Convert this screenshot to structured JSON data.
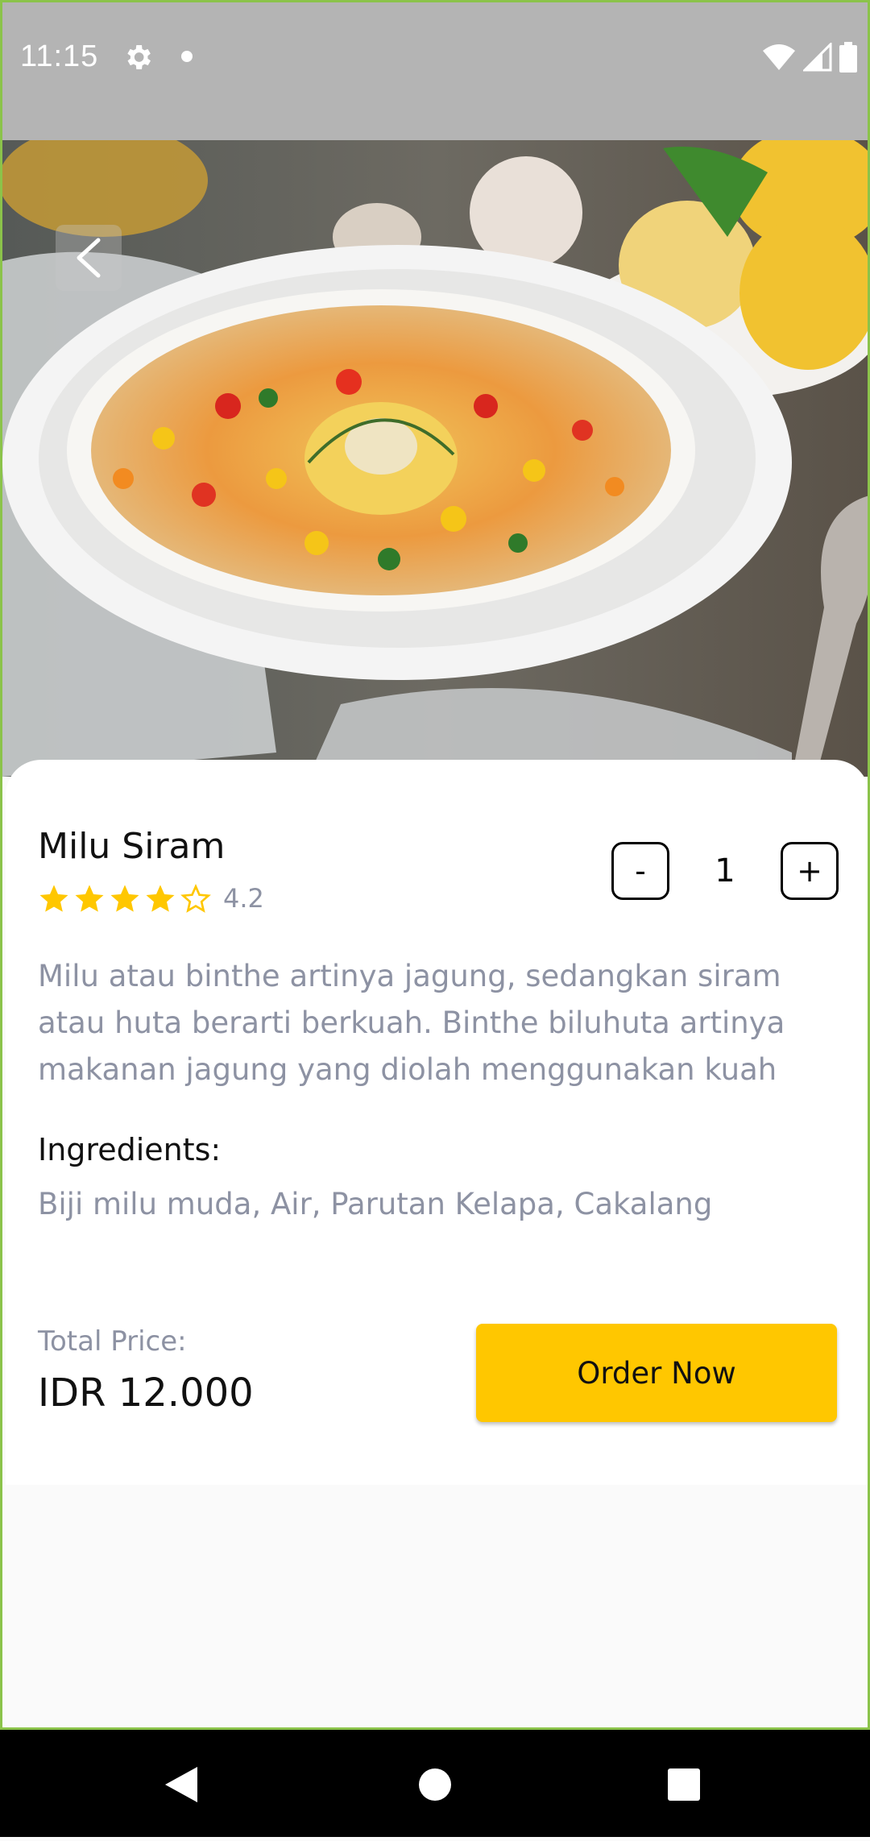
{
  "status_bar": {
    "time": "11:15",
    "icons": [
      "settings-gear-icon",
      "notification-dot-icon",
      "wifi-icon",
      "signal-icon",
      "battery-icon"
    ]
  },
  "hero": {
    "image_description_icon": "corn-soup-photo",
    "back_icon": "chevron-left-icon"
  },
  "food": {
    "name": "Milu Siram",
    "rating_value": "4.2",
    "rating_stars": 4.2,
    "rating_max": 5,
    "quantity": "1",
    "decrement_label": "-",
    "increment_label": "+",
    "description": "Milu atau binthe artinya jagung, sedangkan siram atau huta berarti berkuah. Binthe biluhuta artinya makanan jagung yang diolah menggunakan kuah",
    "ingredients_label": "Ingredients:",
    "ingredients": "Biji milu muda, Air, Parutan Kelapa, Cakalang"
  },
  "checkout": {
    "total_label": "Total Price:",
    "total_value": "IDR 12.000",
    "order_label": "Order Now"
  },
  "colors": {
    "accent": "#FFC700",
    "star": "#FFC700",
    "muted_text": "#8D92A3",
    "status_bar_bg": "#B4B4B4",
    "frame_border": "#8BC34A"
  },
  "nav_bar": {
    "icons": [
      "back-triangle-icon",
      "home-circle-icon",
      "recents-square-icon"
    ]
  }
}
